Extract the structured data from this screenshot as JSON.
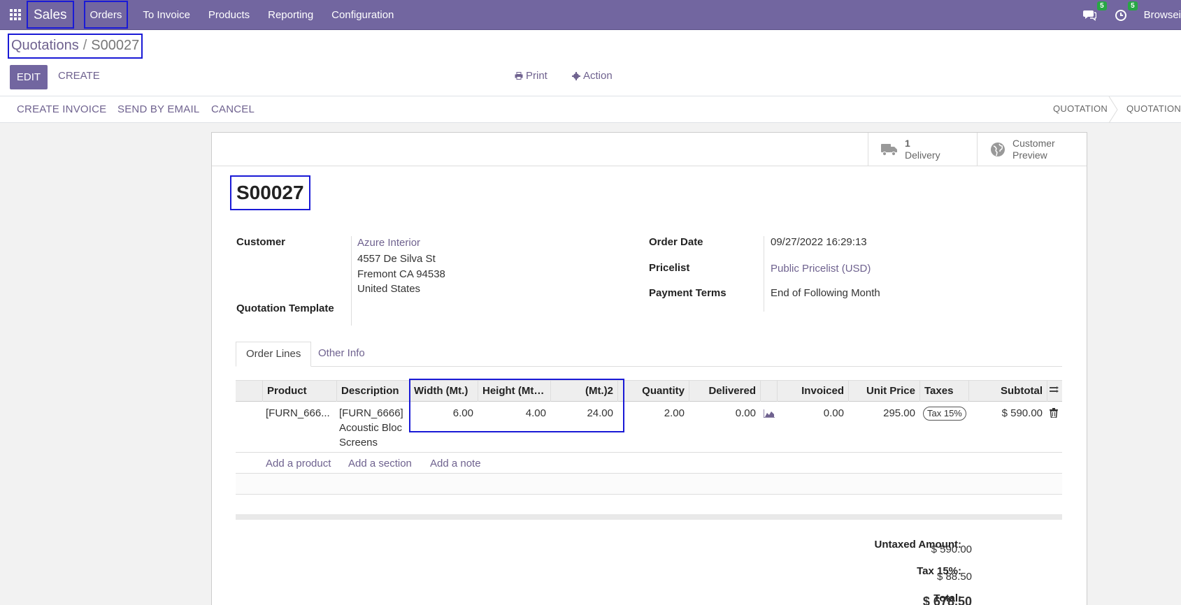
{
  "topbar": {
    "app_name": "Sales",
    "menu": [
      "Orders",
      "To Invoice",
      "Products",
      "Reporting",
      "Configuration"
    ],
    "messages_count": "5",
    "activities_count": "5",
    "user": "Browsei"
  },
  "control_panel": {
    "breadcrumb_parent": "Quotations",
    "breadcrumb_separator": "/",
    "breadcrumb_current": "S00027",
    "edit_label": "EDIT",
    "create_label": "CREATE",
    "print_label": "Print",
    "action_label": "Action"
  },
  "statusbar": {
    "buttons": [
      "CREATE INVOICE",
      "SEND BY EMAIL",
      "CANCEL"
    ],
    "stages": [
      "QUOTATION",
      "QUOTATION S"
    ]
  },
  "smart_buttons": {
    "delivery_count": "1",
    "delivery_label": "Delivery",
    "preview_line1": "Customer",
    "preview_line2": "Preview"
  },
  "form": {
    "title": "S00027",
    "customer_label": "Customer",
    "customer_name": "Azure Interior",
    "customer_street": "4557 De Silva St",
    "customer_city": "Fremont CA 94538",
    "customer_country": "United States",
    "template_label": "Quotation Template",
    "template_value": "",
    "order_date_label": "Order Date",
    "order_date": "09/27/2022 16:29:13",
    "pricelist_label": "Pricelist",
    "pricelist": "Public Pricelist (USD)",
    "payment_terms_label": "Payment Terms",
    "payment_terms": "End of Following Month"
  },
  "tabs": [
    "Order Lines",
    "Other Info"
  ],
  "order_lines": {
    "columns": [
      "Product",
      "Description",
      "Width (Mt.)",
      "Height (Mt.)...",
      "(Mt.)2",
      "Quantity",
      "Delivered",
      "Invoiced",
      "Unit Price",
      "Taxes",
      "Subtotal"
    ],
    "rows": [
      {
        "product": "[FURN_666...",
        "description_line1": "[FURN_6666]",
        "description_line2": "Acoustic Bloc",
        "description_line3": "Screens",
        "width": "6.00",
        "height": "4.00",
        "area": "24.00",
        "quantity": "2.00",
        "delivered": "0.00",
        "invoiced": "0.00",
        "unit_price": "295.00",
        "taxes": "Tax 15%",
        "subtotal": "$ 590.00"
      }
    ],
    "add_product": "Add a product",
    "add_section": "Add a section",
    "add_note": "Add a note"
  },
  "totals": {
    "untaxed_label": "Untaxed Amount:",
    "untaxed_value": "$ 590.00",
    "tax_label": "Tax 15%:",
    "tax_value": "$ 88.50",
    "total_label": "Total:",
    "total_value": "$ 678.50"
  },
  "colors": {
    "brand": "#7266a0",
    "link": "#6f628f",
    "highlight_box": "#1a1ad6",
    "badge": "#28a745"
  }
}
